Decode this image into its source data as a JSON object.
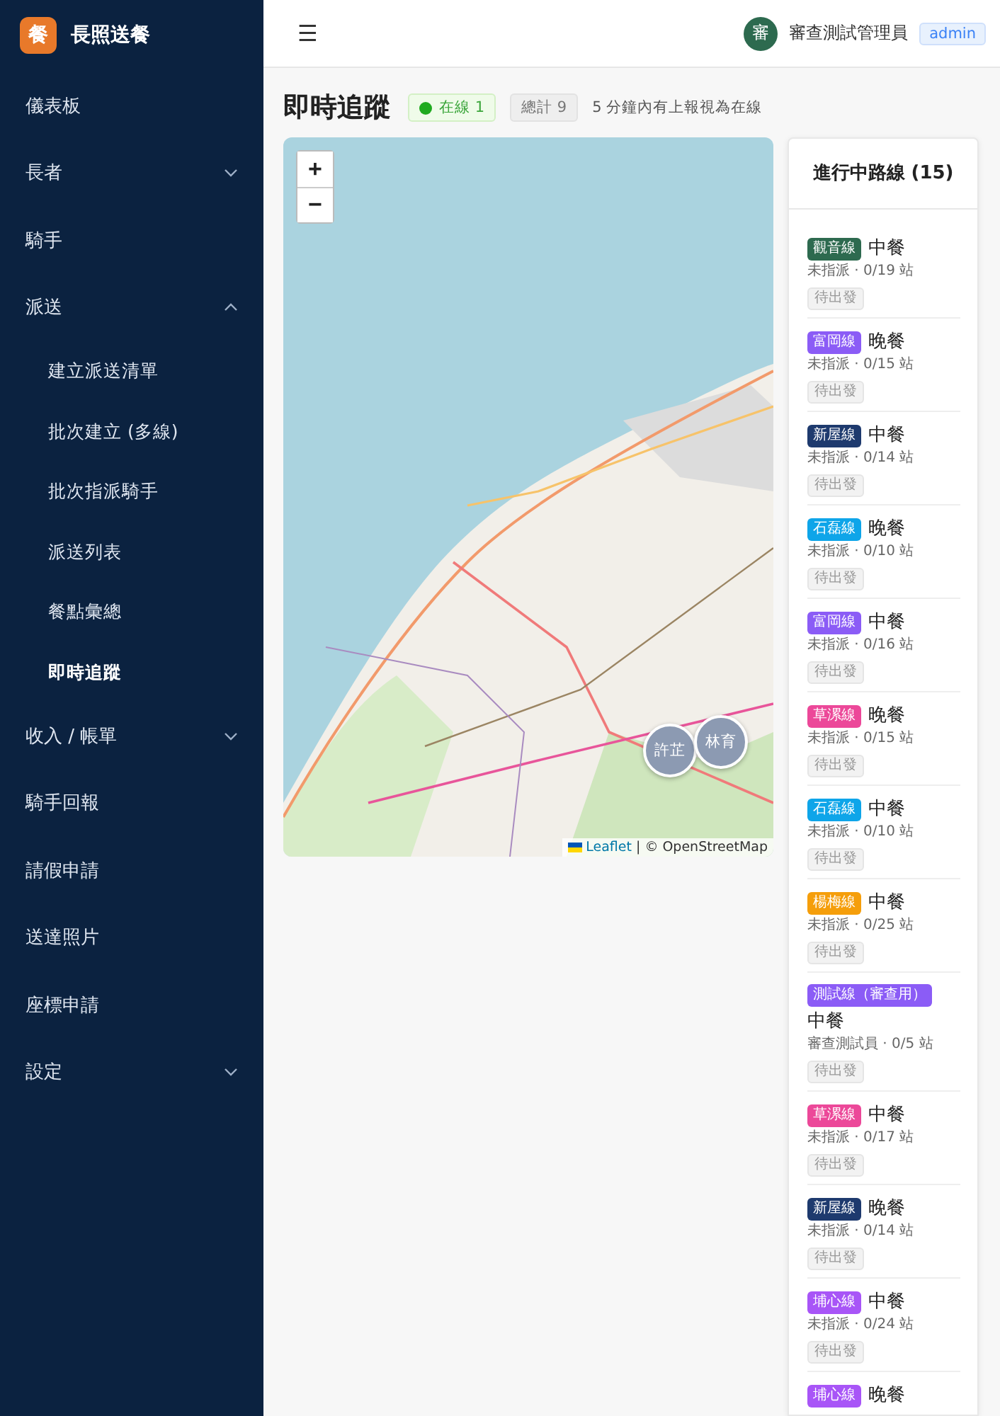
{
  "app": {
    "logo": "餐",
    "name": "長照送餐"
  },
  "sidebar": {
    "items": [
      {
        "label": "儀表板",
        "expandable": false,
        "selected": false
      },
      {
        "label": "長者",
        "expandable": true,
        "expanded": false,
        "selected": false
      },
      {
        "label": "騎手",
        "expandable": false,
        "selected": false
      },
      {
        "label": "派送",
        "expandable": true,
        "expanded": true,
        "selected": false,
        "children": [
          {
            "label": "建立派送清單",
            "selected": false
          },
          {
            "label": "批次建立 (多線)",
            "selected": false
          },
          {
            "label": "批次指派騎手",
            "selected": false
          },
          {
            "label": "派送列表",
            "selected": false
          },
          {
            "label": "餐點彙總",
            "selected": false
          },
          {
            "label": "即時追蹤",
            "selected": true
          }
        ]
      },
      {
        "label": "收入 / 帳單",
        "expandable": true,
        "expanded": false,
        "selected": false
      },
      {
        "label": "騎手回報",
        "expandable": false,
        "selected": false
      },
      {
        "label": "請假申請",
        "expandable": false,
        "selected": false
      },
      {
        "label": "送達照片",
        "expandable": false,
        "selected": false
      },
      {
        "label": "座標申請",
        "expandable": false,
        "selected": false
      },
      {
        "label": "設定",
        "expandable": true,
        "expanded": false,
        "selected": false
      }
    ]
  },
  "header": {
    "menu_icon": "☰",
    "user_avatar": "審",
    "user_name": "審查測試管理員",
    "role": "admin"
  },
  "page": {
    "title": "即時追蹤",
    "online_badge": "在線 1",
    "total_badge": "總計 9",
    "note": "5 分鐘內有上報視為在線"
  },
  "map": {
    "kind": "picture",
    "zoom_in": "+",
    "zoom_out": "−",
    "markers": [
      {
        "label": "許芷"
      },
      {
        "label": "林育"
      }
    ],
    "attribution_link": "Leaflet",
    "attribution_text": "| © OpenStreetMap"
  },
  "routes": {
    "title": "進行中路線 (15)",
    "items": [
      {
        "tag": "觀音線",
        "color": "#2d6a4f",
        "meal": "中餐",
        "info": "未指派 · 0/19 站",
        "status": "待出發"
      },
      {
        "tag": "富岡線",
        "color": "#8b5cf6",
        "meal": "晚餐",
        "info": "未指派 · 0/15 站",
        "status": "待出發"
      },
      {
        "tag": "新屋線",
        "color": "#1e3a6e",
        "meal": "中餐",
        "info": "未指派 · 0/14 站",
        "status": "待出發"
      },
      {
        "tag": "石磊線",
        "color": "#0ea5e9",
        "meal": "晚餐",
        "info": "未指派 · 0/10 站",
        "status": "待出發"
      },
      {
        "tag": "富岡線",
        "color": "#8b5cf6",
        "meal": "中餐",
        "info": "未指派 · 0/16 站",
        "status": "待出發"
      },
      {
        "tag": "草漯線",
        "color": "#ec4899",
        "meal": "晚餐",
        "info": "未指派 · 0/15 站",
        "status": "待出發"
      },
      {
        "tag": "石磊線",
        "color": "#0ea5e9",
        "meal": "中餐",
        "info": "未指派 · 0/10 站",
        "status": "待出發"
      },
      {
        "tag": "楊梅線",
        "color": "#f59e0b",
        "meal": "中餐",
        "info": "未指派 · 0/25 站",
        "status": "待出發"
      },
      {
        "tag": "測試線（審查用）",
        "color": "#8b5cf6",
        "meal": "中餐",
        "info": "審查測試員 · 0/5 站",
        "status": "待出發"
      },
      {
        "tag": "草漯線",
        "color": "#ec4899",
        "meal": "中餐",
        "info": "未指派 · 0/17 站",
        "status": "待出發"
      },
      {
        "tag": "新屋線",
        "color": "#1e3a6e",
        "meal": "晚餐",
        "info": "未指派 · 0/14 站",
        "status": "待出發"
      },
      {
        "tag": "埔心線",
        "color": "#a855f7",
        "meal": "中餐",
        "info": "未指派 · 0/24 站",
        "status": "待出發"
      },
      {
        "tag": "埔心線",
        "color": "#a855f7",
        "meal": "晚餐"
      }
    ]
  }
}
